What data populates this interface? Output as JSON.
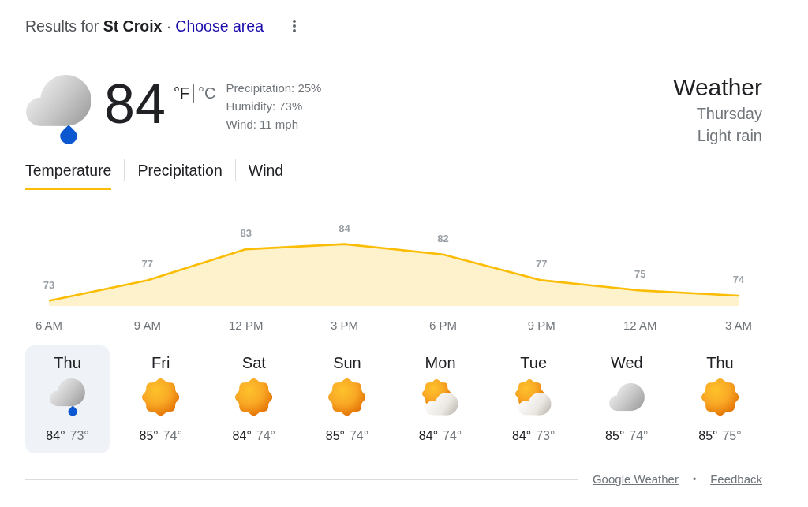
{
  "header": {
    "results_text": "Results for **St Croix** ·",
    "choose_area_link": "Choose area"
  },
  "current": {
    "kind": "rain",
    "temperature": "84",
    "units": [
      {
        "label": "°F",
        "selected": true
      },
      {
        "label": "°C",
        "selected": false
      }
    ],
    "details": [
      "Precipitation: 25%",
      "Humidity: 73%",
      "Wind: 11 mph"
    ]
  },
  "summary": {
    "title": "Weather",
    "day": "Thursday",
    "condition": "Light rain"
  },
  "tabs": [
    {
      "label": "Temperature",
      "selected": true
    },
    {
      "label": "Precipitation",
      "selected": false
    },
    {
      "label": "Wind",
      "selected": false
    }
  ],
  "hourly": {
    "chart_data": {
      "type": "area",
      "categories": [
        "6 AM",
        "9 AM",
        "12 PM",
        "3 PM",
        "6 PM",
        "9 PM",
        "12 AM",
        "3 AM"
      ],
      "series": [
        {
          "color": "#fbbc04",
          "values": [
            73,
            77,
            83,
            84,
            82,
            77,
            75,
            74
          ]
        }
      ],
      "data_labels": true
    }
  },
  "forecast": [
    {
      "day": "Thu",
      "kind": "rain",
      "high": "84°",
      "low": "73°",
      "selected": true
    },
    {
      "day": "Fri",
      "kind": "sunny",
      "high": "85°",
      "low": "74°",
      "selected": false
    },
    {
      "day": "Sat",
      "kind": "sunny",
      "high": "84°",
      "low": "74°",
      "selected": false
    },
    {
      "day": "Sun",
      "kind": "sunny",
      "high": "85°",
      "low": "74°",
      "selected": false
    },
    {
      "day": "Mon",
      "kind": "partly_cloudy",
      "high": "84°",
      "low": "74°",
      "selected": false
    },
    {
      "day": "Tue",
      "kind": "partly_cloudy",
      "high": "84°",
      "low": "73°",
      "selected": false
    },
    {
      "day": "Wed",
      "kind": "cloudy",
      "high": "85°",
      "low": "74°",
      "selected": false
    },
    {
      "day": "Thu",
      "kind": "sunny",
      "high": "85°",
      "low": "75°",
      "selected": false
    }
  ],
  "footer": {
    "links": [
      "Google Weather",
      "Feedback"
    ],
    "separator": "•"
  }
}
